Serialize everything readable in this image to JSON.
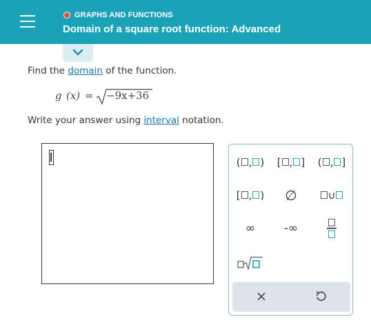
{
  "header": {
    "topic": "GRAPHS AND FUNCTIONS",
    "title": "Domain of a square root function: Advanced"
  },
  "question": {
    "prompt_prefix": "Find the ",
    "prompt_link": "domain",
    "prompt_suffix": " of the function.",
    "formula": {
      "fn": "g",
      "arg": "(x)",
      "equals": "=",
      "radicand": "−9x+36"
    },
    "instruction_prefix": "Write your answer using ",
    "instruction_link": "interval",
    "instruction_suffix": " notation."
  },
  "answer": {
    "value": ""
  },
  "palette": {
    "infinity": "∞",
    "neg_infinity": "-∞",
    "empty_set": "∅",
    "icons": [
      "open-open-interval-icon",
      "closed-closed-interval-icon",
      "open-closed-interval-icon",
      "closed-open-interval-icon",
      "empty-set-icon",
      "union-icon",
      "infinity-icon",
      "negative-infinity-icon",
      "fraction-icon",
      "nth-root-icon",
      "clear-icon",
      "undo-icon"
    ]
  },
  "colors": {
    "header_bg": "#1aa3b8",
    "topic_dot": "#ef4a2c",
    "link": "#1a73a8",
    "palette_border": "#8fb6c7",
    "footer_bg": "#dde3e8"
  }
}
